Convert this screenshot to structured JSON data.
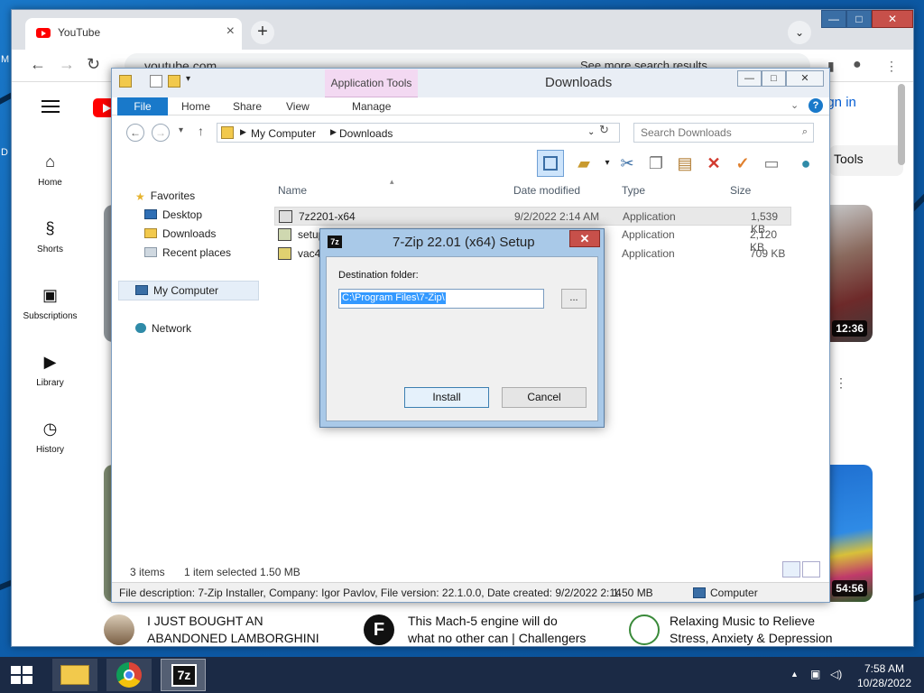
{
  "desktop": {
    "edge_left_top": "M",
    "edge_left_mid": "D"
  },
  "chrome": {
    "tab_title": "YouTube",
    "new_tab": "+",
    "url": "youtube.com",
    "google_hint": "See more search results",
    "window_controls": {
      "minimize": "—",
      "maximize": "□",
      "close": "✕"
    }
  },
  "youtube": {
    "sign_in": "Sign in",
    "tools_chip": "Tools",
    "sidebar": [
      {
        "label": "Home",
        "icon": "home-icon"
      },
      {
        "label": "Shorts",
        "icon": "shorts-icon"
      },
      {
        "label": "Subscriptions",
        "icon": "subscriptions-icon"
      },
      {
        "label": "Library",
        "icon": "library-icon"
      },
      {
        "label": "History",
        "icon": "history-icon"
      }
    ],
    "durations": [
      "12:36",
      "54:56"
    ],
    "videos": [
      {
        "title_line1": "I JUST BOUGHT AN",
        "title_line2": "ABANDONED LAMBORGHINI"
      },
      {
        "title_line1": "This Mach-5 engine will do",
        "title_line2": "what no other can | Challengers"
      },
      {
        "title_line1": "Relaxing Music to Relieve",
        "title_line2": "Stress, Anxiety & Depression"
      }
    ],
    "more": "⋮"
  },
  "explorer": {
    "title": "Downloads",
    "app_tools": "Application Tools",
    "ribbon_tabs": [
      "File",
      "Home",
      "Share",
      "View",
      "Manage"
    ],
    "breadcrumb": [
      "My Computer",
      "Downloads"
    ],
    "search_placeholder": "Search Downloads",
    "nav": {
      "favorites": "Favorites",
      "desktop": "Desktop",
      "downloads": "Downloads",
      "recent": "Recent places",
      "computer": "My Computer",
      "network": "Network"
    },
    "columns": [
      "Name",
      "Date modified",
      "Type",
      "Size"
    ],
    "files": [
      {
        "name": "7z2201-x64",
        "date": "9/2/2022 2:14 AM",
        "type": "Application",
        "size": "1,539 KB"
      },
      {
        "name": "setup",
        "date": "",
        "type": "Application",
        "size": "2,120 KB"
      },
      {
        "name": "vac4",
        "date": "",
        "type": "Application",
        "size": "709 KB"
      }
    ],
    "status_items": "3 items",
    "status_selected": "1 item selected  1.50 MB",
    "info_desc": "File description: 7-Zip Installer, Company: Igor Pavlov, File version: 22.1.0.0, Date created: 9/2/2022 2:14",
    "info_size": "1.50 MB",
    "info_location": "Computer"
  },
  "dialog": {
    "title": "7-Zip 22.01 (x64) Setup",
    "icon_text": "7z",
    "dest_label": "Destination folder:",
    "dest_value": "C:\\Program Files\\7-Zip\\",
    "browse": "...",
    "install": "Install",
    "cancel": "Cancel"
  },
  "taskbar": {
    "time": "7:58 AM",
    "date": "10/28/2022",
    "zip_icon_text": "7z"
  }
}
